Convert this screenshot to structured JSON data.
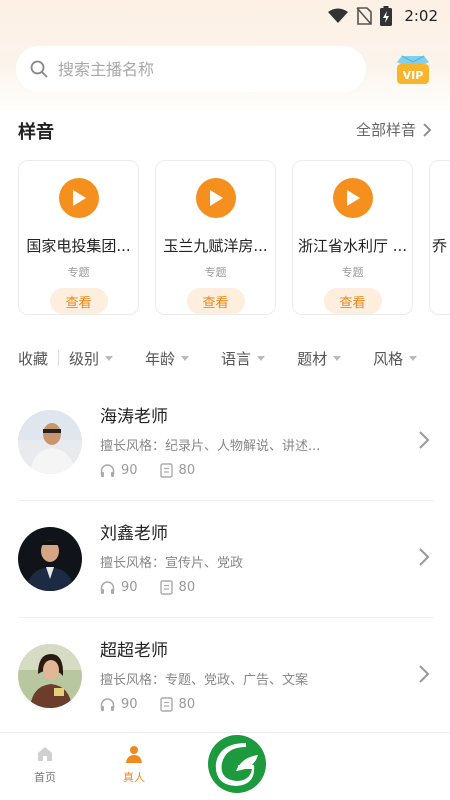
{
  "status_bar": {
    "time": "2:02"
  },
  "search": {
    "placeholder": "搜索主播名称"
  },
  "samples": {
    "title": "样音",
    "more": "全部样音",
    "cards": [
      {
        "name": "国家电投集团...",
        "tag": "专题",
        "button": "查看"
      },
      {
        "name": "玉兰九赋洋房...",
        "tag": "专题",
        "button": "查看"
      },
      {
        "name": "浙江省水利厅 ...",
        "tag": "专题",
        "button": "查看"
      },
      {
        "name": "乔",
        "tag": "",
        "button": ""
      }
    ]
  },
  "filters": {
    "favorite": "收藏",
    "items": [
      "级别",
      "年龄",
      "语言",
      "题材",
      "风格"
    ]
  },
  "teachers": [
    {
      "name": "海涛老师",
      "style": "擅长风格：纪录片、人物解说、讲述...",
      "listens": "90",
      "works": "80"
    },
    {
      "name": "刘鑫老师",
      "style": "擅长风格：宣传片、党政",
      "listens": "90",
      "works": "80"
    },
    {
      "name": "超超老师",
      "style": "擅长风格：专题、党政、广告、文案",
      "listens": "90",
      "works": "80"
    }
  ],
  "tabbar": {
    "home": "首页",
    "real": "真人"
  },
  "colors": {
    "accent": "#f5901e",
    "tab_active": "#f08a1c",
    "logo_green": "#1e9a3e"
  },
  "icons": [
    "search-icon",
    "vip-icon",
    "play-icon",
    "chevron-right-icon",
    "headphones-icon",
    "document-icon",
    "home-icon",
    "person-icon"
  ]
}
